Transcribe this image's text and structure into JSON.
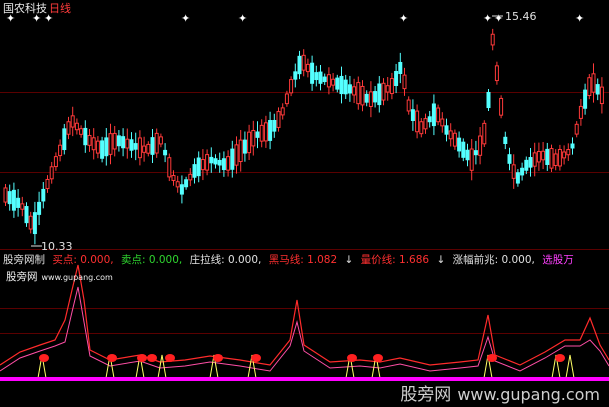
{
  "header": {
    "title": "国农科技",
    "period": "日线"
  },
  "price_labels": {
    "high": "15.46",
    "low": "10.33"
  },
  "indicator_bar": {
    "name": "股旁网制",
    "items": [
      {
        "label": "买点: 0.000,",
        "color": "#ff3030"
      },
      {
        "label": "卖点: 0.000,",
        "color": "#2fd52f"
      },
      {
        "label": "庄拉线: 0.000,",
        "color": "#e0e0e0"
      },
      {
        "label": "黑马线: 1.082",
        "color": "#ff3030"
      },
      {
        "label": "↓",
        "color": "#e0e0e0"
      },
      {
        "label": "量价线: 1.686",
        "color": "#ff3030"
      },
      {
        "label": "↓",
        "color": "#e0e0e0"
      },
      {
        "label": "涨幅前兆: 0.000,",
        "color": "#e0e0e0"
      },
      {
        "label": "选股万",
        "color": "#ff40ff"
      }
    ]
  },
  "site": {
    "name": "股旁网",
    "url": "www.gupang.com"
  },
  "watermark": {
    "name": "股旁网",
    "url": "www.gupang.com"
  },
  "colors": {
    "up": "#ff3a3a",
    "down": "#54ffff",
    "line_red": "#ff2b2b",
    "line_pink": "#ff4fa6",
    "baseline": "#ff00ff",
    "spike": "#ffff66",
    "dot": "#ff2020",
    "divider": "#7a0000"
  }
}
